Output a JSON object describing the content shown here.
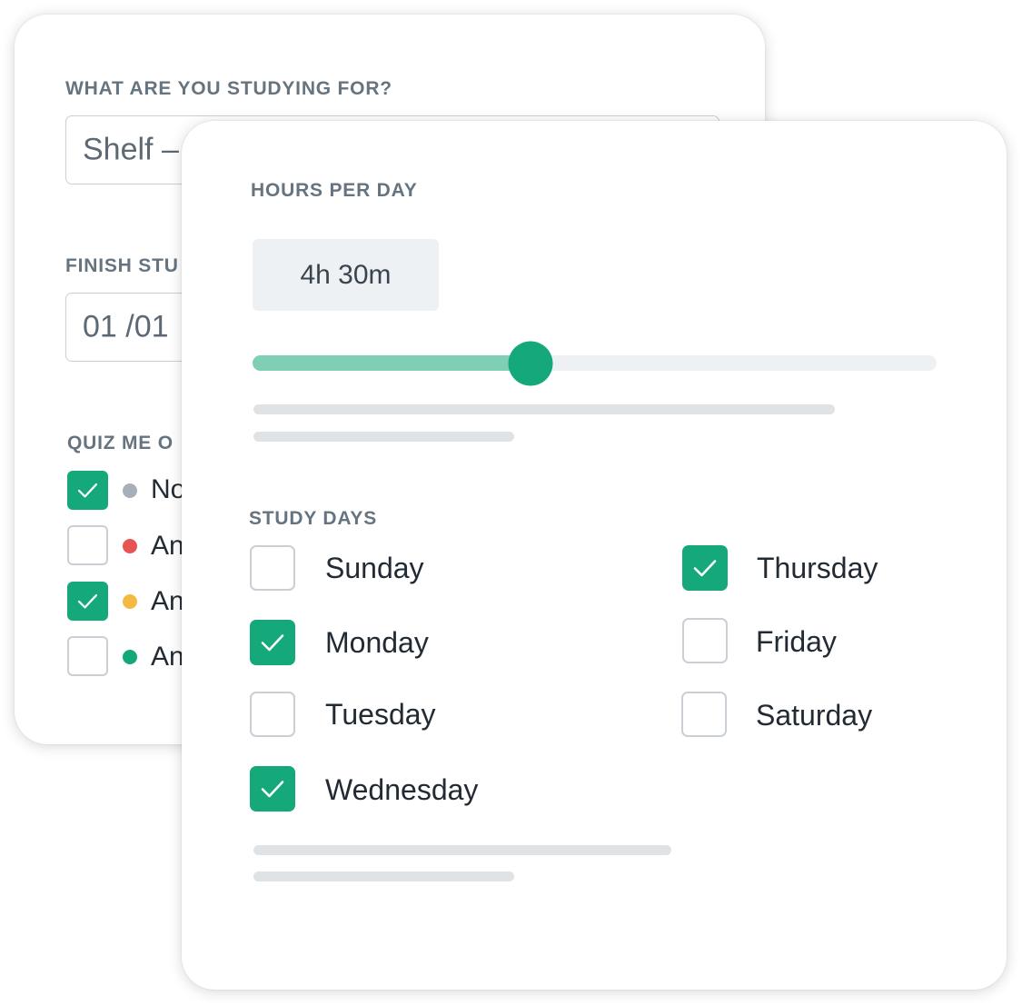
{
  "back_card": {
    "goal_label": "WHAT ARE YOU STUDYING FOR?",
    "goal_value": "Shelf –",
    "finish_label": "FINISH STU",
    "finish_value": "01 /01",
    "quiz_label": "QUIZ ME O",
    "quiz_options": [
      {
        "text": "No",
        "checked": true,
        "dot_color": "#a7b0b8"
      },
      {
        "text": "An",
        "checked": false,
        "dot_color": "#e85454"
      },
      {
        "text": "An",
        "checked": true,
        "dot_color": "#f4b942"
      },
      {
        "text": "An",
        "checked": false,
        "dot_color": "#14a77a"
      }
    ]
  },
  "front_card": {
    "hours_label": "HOURS PER DAY",
    "hours_value": "4h 30m",
    "hours_slider_fraction": 0.406,
    "study_days_label": "STUDY DAYS",
    "days": [
      {
        "name": "Sunday",
        "checked": false
      },
      {
        "name": "Monday",
        "checked": true
      },
      {
        "name": "Tuesday",
        "checked": false
      },
      {
        "name": "Wednesday",
        "checked": true
      },
      {
        "name": "Thursday",
        "checked": true
      },
      {
        "name": "Friday",
        "checked": false
      },
      {
        "name": "Saturday",
        "checked": false
      }
    ]
  },
  "colors": {
    "accent": "#15a87b",
    "accent_light": "#7fcfb6",
    "label": "#667480",
    "border": "#c9cfd5"
  }
}
